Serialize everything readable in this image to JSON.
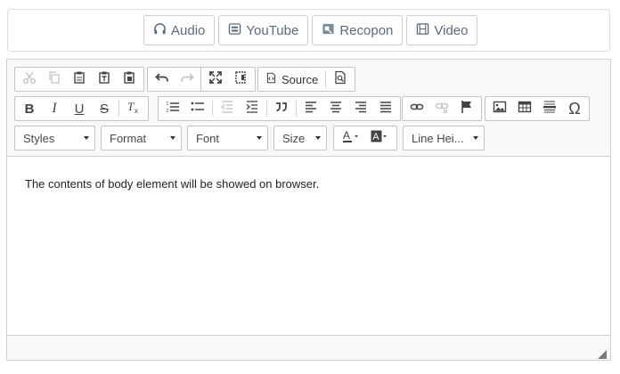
{
  "top_buttons": [
    {
      "label": "Audio",
      "icon": "headphones-icon"
    },
    {
      "label": "YouTube",
      "icon": "youtube-icon"
    },
    {
      "label": "Recopon",
      "icon": "recopon-icon"
    },
    {
      "label": "Video",
      "icon": "film-icon"
    }
  ],
  "toolbar": {
    "source_label": "Source",
    "combos": {
      "styles": "Styles",
      "format": "Format",
      "font": "Font",
      "size": "Size",
      "line_height": "Line Hei..."
    },
    "bold_glyph": "B",
    "italic_glyph": "I",
    "underline_glyph": "U",
    "strike_glyph": "S",
    "omega_glyph": "Ω"
  },
  "content": {
    "text": "The contents of body element will be showed on browser."
  },
  "colors": {
    "accent": "#5a6b7d",
    "toolbar_bg": "#f8f8f8",
    "border": "#d1d1d1"
  }
}
